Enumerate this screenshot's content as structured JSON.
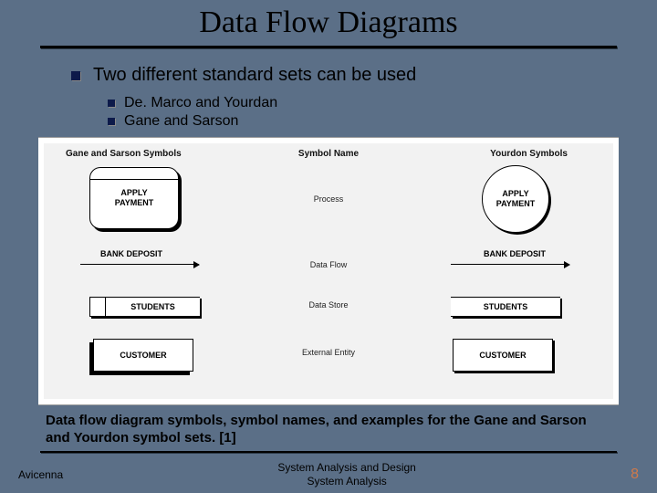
{
  "title": "Data Flow Diagrams",
  "bullets": {
    "main": "Two different standard sets can be used",
    "sub": [
      "De. Marco and Yourdan",
      "Gane and Sarson"
    ]
  },
  "figure": {
    "headers": {
      "left": "Gane and Sarson Symbols",
      "mid": "Symbol Name",
      "right": "Yourdon Symbols"
    },
    "process_label": "APPLY\nPAYMENT",
    "flow_label": "BANK DEPOSIT",
    "datastore_label": "STUDENTS",
    "entity_label": "CUSTOMER",
    "names": {
      "process": "Process",
      "flow": "Data Flow",
      "store": "Data Store",
      "entity": "External Entity"
    }
  },
  "caption": "Data flow diagram symbols, symbol names, and examples for the Gane and Sarson and Yourdon symbol sets. [1]",
  "footer": {
    "author": "Avicenna",
    "course_line1": "System Analysis and Design",
    "course_line2": "System Analysis",
    "page": "8"
  }
}
